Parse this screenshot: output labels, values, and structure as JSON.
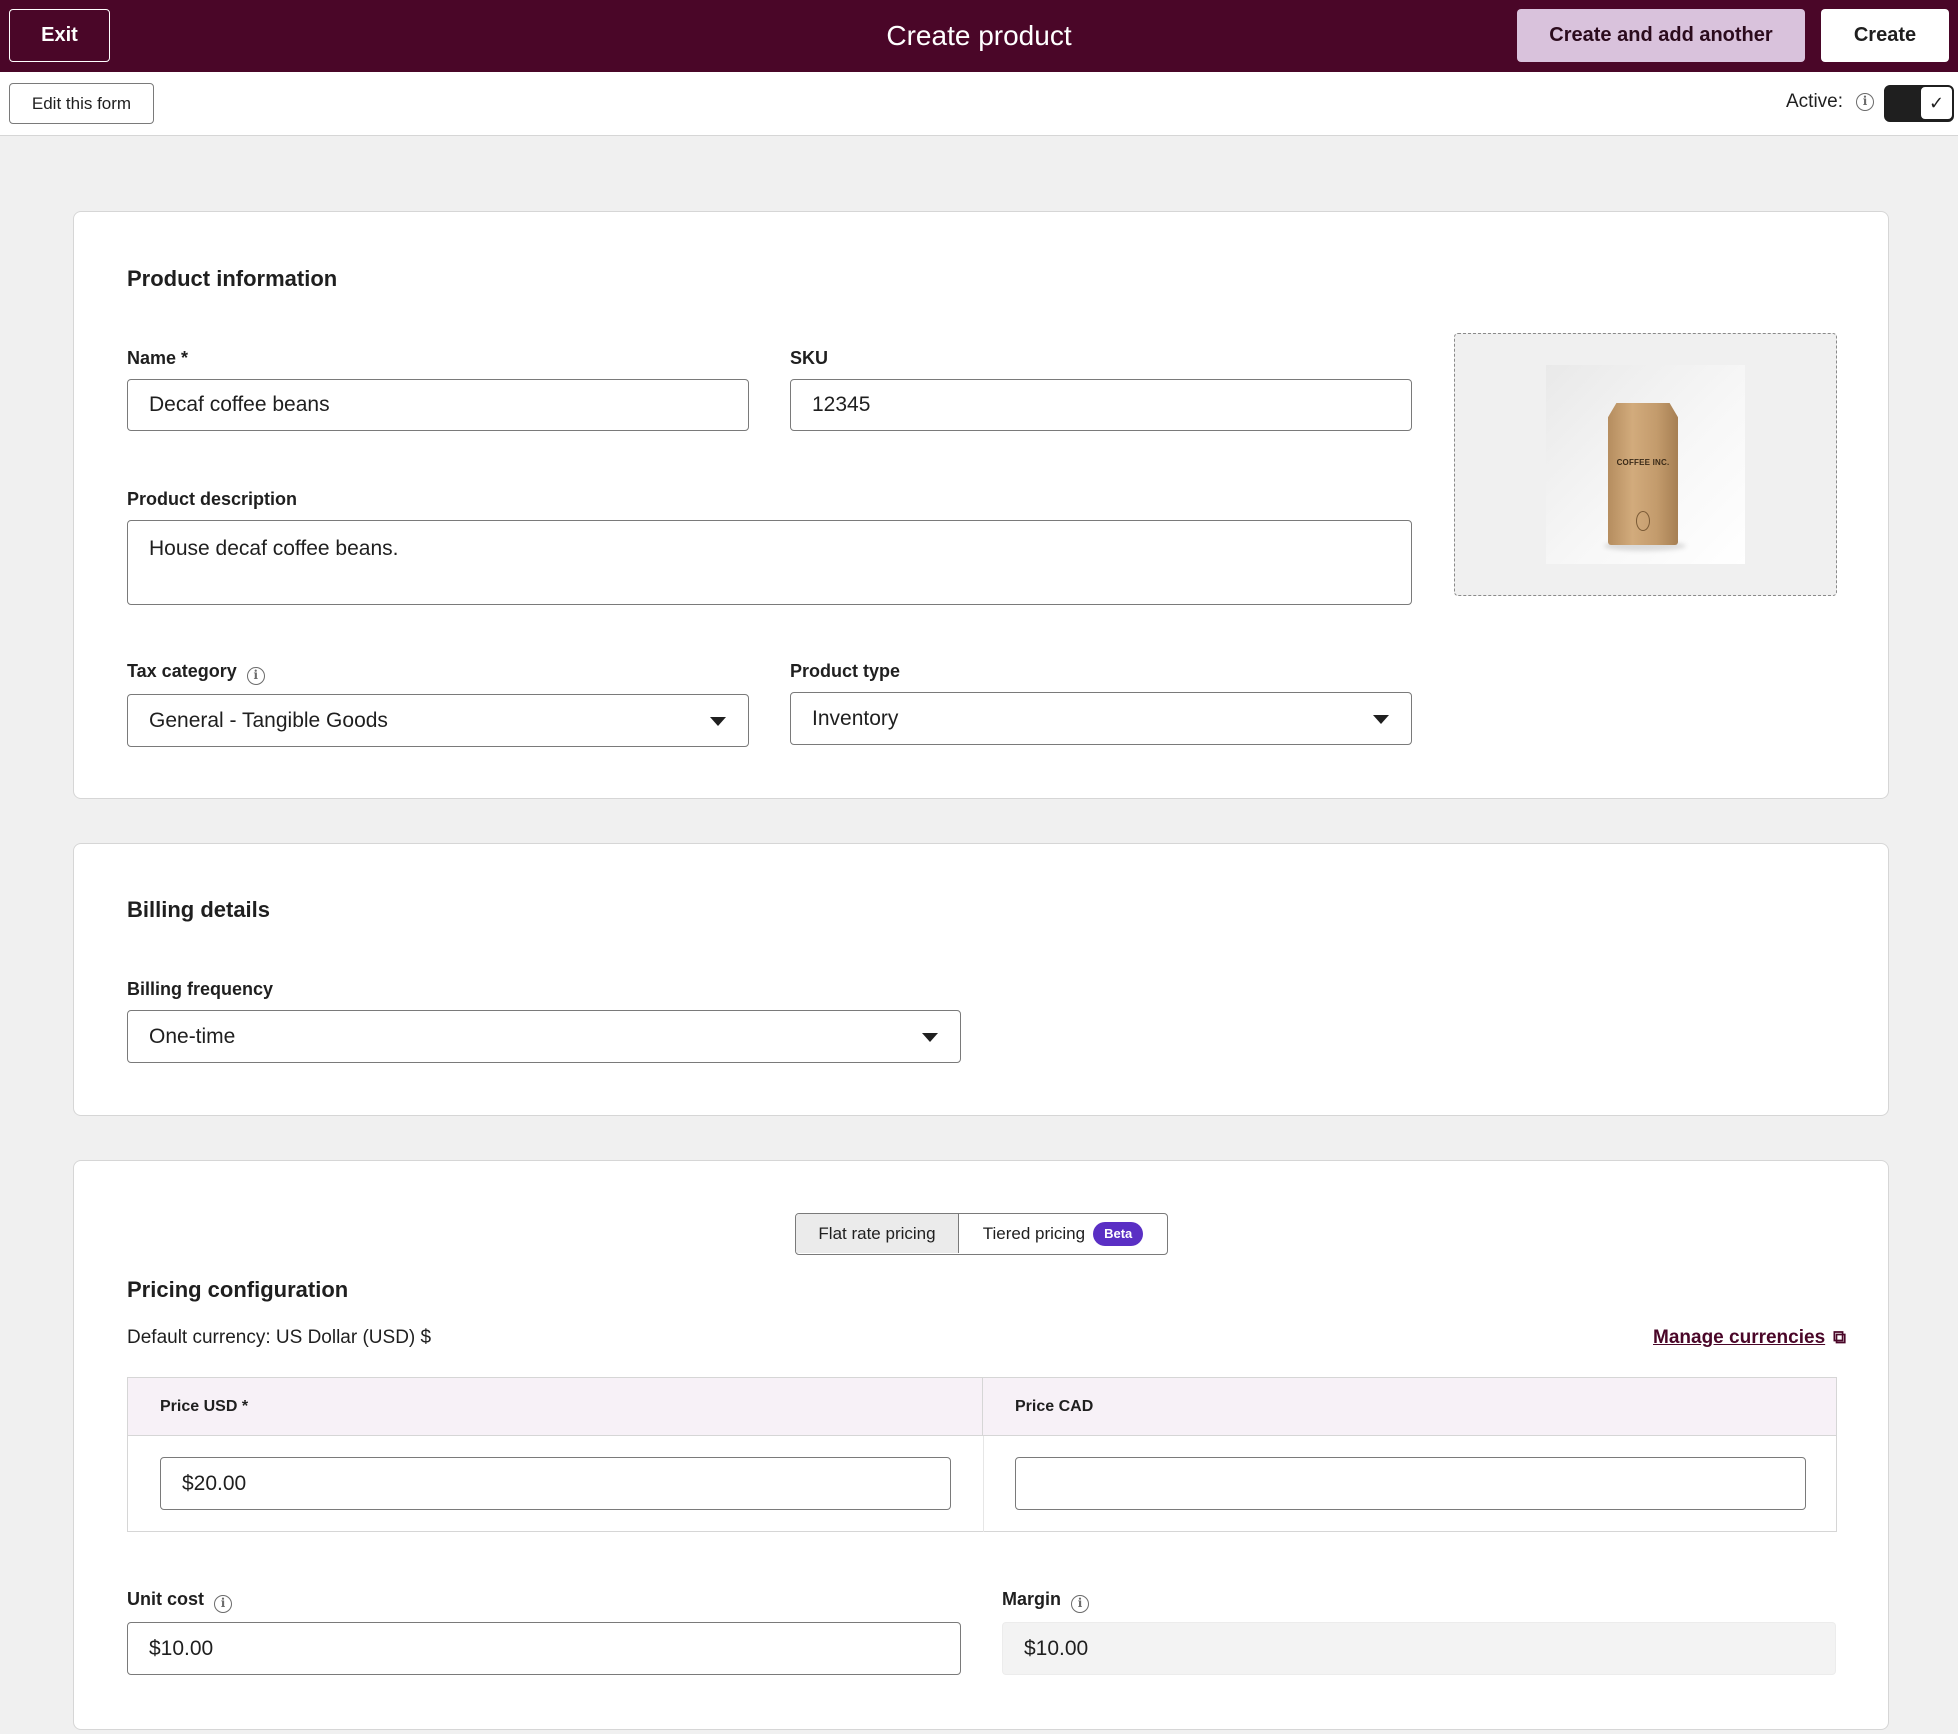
{
  "header": {
    "exit_label": "Exit",
    "title": "Create product",
    "create_another_label": "Create and add another",
    "create_label": "Create",
    "bg_color": "#4a0628"
  },
  "subbar": {
    "edit_form_label": "Edit this form",
    "active_label": "Active:",
    "active_checked": true
  },
  "product_info": {
    "section_title": "Product information",
    "name": {
      "label": "Name *",
      "value": "Decaf coffee beans"
    },
    "sku": {
      "label": "SKU",
      "value": "12345"
    },
    "description": {
      "label": "Product description",
      "value": "House decaf coffee beans."
    },
    "tax_category": {
      "label": "Tax category",
      "value": "General - Tangible Goods"
    },
    "product_type": {
      "label": "Product type",
      "value": "Inventory"
    },
    "image": {
      "bag_text": "COFFEE INC."
    }
  },
  "billing": {
    "section_title": "Billing details",
    "frequency": {
      "label": "Billing frequency",
      "value": "One-time"
    }
  },
  "pricing": {
    "tabs": {
      "flat": "Flat rate pricing",
      "tiered": "Tiered pricing",
      "badge": "Beta",
      "selected": "flat"
    },
    "section_title": "Pricing configuration",
    "default_currency": "Default currency: US Dollar (USD) $",
    "manage_link": "Manage currencies",
    "columns": [
      {
        "header": "Price USD *",
        "value": "$20.00"
      },
      {
        "header": "Price CAD",
        "value": ""
      }
    ],
    "unit_cost": {
      "label": "Unit cost",
      "value": "$10.00"
    },
    "margin": {
      "label": "Margin",
      "value": "$10.00"
    }
  }
}
